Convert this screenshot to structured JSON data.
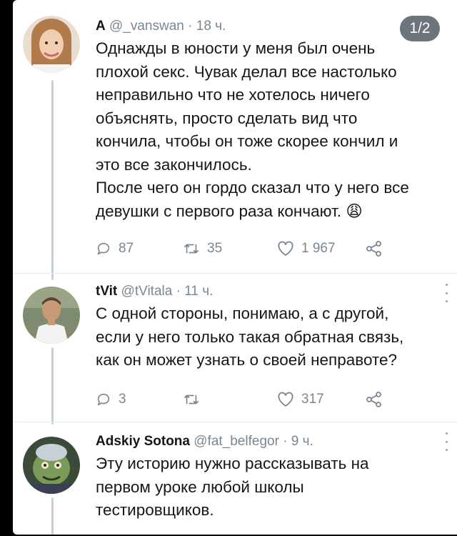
{
  "counter": "1/2",
  "tweets": [
    {
      "author": "A",
      "handle": "@_vanswan",
      "time": "· 18 ч.",
      "lines": [
        "Однажды в юности у меня был очень",
        "плохой секс. Чувак делал все настолько",
        "неправильно что не хотелось ничего",
        "объяснять, просто сделать вид что",
        "кончила, чтобы он тоже скорее кончил и",
        "это все закончилось.",
        "После чего он гордо сказал что у него все",
        "девушки с первого раза кончают."
      ],
      "emoji": "😩",
      "replies": "87",
      "retweets": "35",
      "likes": "1 967"
    },
    {
      "author": "tVit",
      "handle": "@tVitala",
      "time": "· 11 ч.",
      "lines": [
        "С одной стороны, понимаю, а с другой,",
        "если у него только такая обратная связь,",
        "как он может узнать о своей неправоте?"
      ],
      "replies": "3",
      "retweets": "",
      "likes": "317"
    },
    {
      "author": "Adskiy Sotona",
      "handle": "@fat_belfegor",
      "time": "· 9 ч.",
      "lines": [
        "Эту историю нужно рассказывать на",
        "первом уроке любой школы",
        "тестировщиков."
      ]
    }
  ],
  "colors": {
    "text": "#14171a",
    "muted": "#7a8793",
    "thread": "#c8d0d6",
    "background": "#000000"
  }
}
